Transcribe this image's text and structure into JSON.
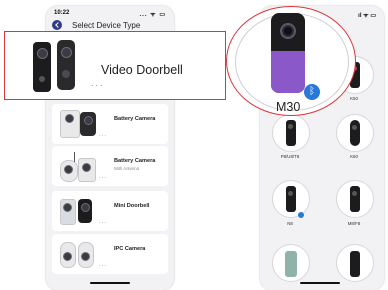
{
  "left_phone": {
    "status": {
      "time": "10:22",
      "signal": "... ᯤ ▭"
    },
    "title": "Select Device Type",
    "cards": [
      {
        "label": "Battery Camera",
        "sub": "",
        "dots": "..."
      },
      {
        "label": "Battery Camera",
        "sub": "With Antenna",
        "dots": "..."
      },
      {
        "label": "Mini Doorbell",
        "sub": "",
        "dots": "..."
      },
      {
        "label": "IPC Camera",
        "sub": "",
        "dots": "..."
      }
    ]
  },
  "popup": {
    "label": "Video Doorbell",
    "dots": "..."
  },
  "zoom": {
    "label": "M30",
    "bluetooth_icon": "ᛒ"
  },
  "right_phone": {
    "status": "ıl ᯤ ▭",
    "labels": {
      "r1_right": "K50",
      "r2_left": "P8/U8/T8",
      "r2_right": "K60",
      "r3_left": "N8",
      "r3_right": "M8/F8"
    }
  },
  "colors": {
    "highlight": "#d9373b",
    "accent_blue": "#2f3a8f",
    "bluetooth": "#2a78d6",
    "purple": "#8a58c8"
  }
}
